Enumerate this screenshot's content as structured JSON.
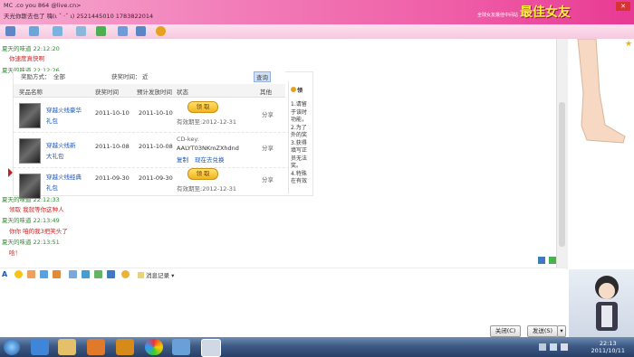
{
  "banner": {
    "row1": "MC .co          you         864              @live.cn>",
    "row2": "天光你斯去也了    嗨(ι    ˇ ·ˇ ι)   2521445010         1783822014",
    "promo": "最佳女友",
    "promo_sub": "全球女友最佳中间站"
  },
  "chat": {
    "messages": [
      {
        "sender": "夏天的味道",
        "time": "22:12:20",
        "text": "你速度真快啊"
      },
      {
        "sender": "夏天的味道",
        "time": "22:12:26",
        "text": ""
      },
      {
        "sender": "夏天的味道",
        "time": "22:12:33",
        "text": "领取   我就等你这种人"
      },
      {
        "sender": "夏天的味道",
        "time": "22:13:49",
        "text": "你你   咱的我3把笑头了"
      },
      {
        "sender": "夏天的味道",
        "time": "22:13:51",
        "text": "哈！"
      }
    ]
  },
  "panel": {
    "filter_label": "奖励方式：",
    "filter_value": "全部",
    "time_label": "获奖时间：",
    "time_value": "近",
    "query_btn": "查询",
    "columns": [
      "奖品名称",
      "获奖时间",
      "预计发放时间",
      "状态",
      "其他"
    ],
    "rows": [
      {
        "name1": "穿越火线豪华",
        "name2": "礼包",
        "won": "2011-10-10",
        "expected": "2011-10-10",
        "status_btn": "领 取",
        "status_note": "有效期至:2012-12-31",
        "other": "分享"
      },
      {
        "name1": "穿越火线新",
        "name2": "大礼包",
        "won": "2011-10-08",
        "expected": "2011-10-08",
        "cdkey_label": "CD-key:",
        "cdkey": "AALYT03NKmZXhdnd",
        "copy": "复制",
        "exchange": "现在去兑换",
        "other": "分享"
      },
      {
        "name1": "穿越火线经典",
        "name2": "礼包",
        "won": "2011-09-30",
        "expected": "2011-09-30",
        "status_btn": "领 取",
        "status_note": "有效期至:2012-12-31",
        "other": "分享"
      }
    ],
    "side_title": "领",
    "side_lines": [
      "1.请留",
      "于该时",
      "功能，",
      "2.为了",
      "外的奖",
      "3.获得",
      "填写正",
      "员无法",
      "奖。",
      "4.特殊",
      "在有效"
    ]
  },
  "fmt": {
    "history": "消息记录"
  },
  "buttons": {
    "close": "关闭(C)",
    "send": "发送(S)"
  },
  "taskbar": {
    "time": "22:13",
    "date": "2011/10/11"
  },
  "colors": {
    "banner": "#ef5fa8",
    "sender": "#2e8b2e",
    "message": "#d21f1f",
    "link": "#1a56b8"
  }
}
